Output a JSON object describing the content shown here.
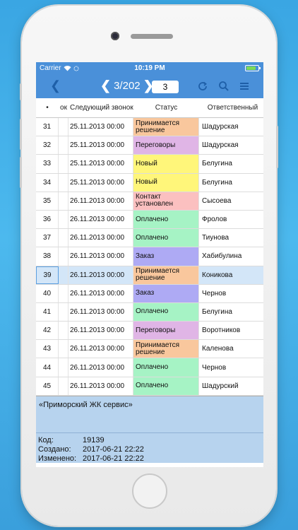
{
  "status_bar": {
    "carrier": "Carrier",
    "time": "10:19 PM",
    "battery_level": 0.8
  },
  "nav": {
    "pager": "3/202",
    "page_value": "3"
  },
  "columns": {
    "num": "•",
    "ok": "ок",
    "date": "Следующий звонок",
    "status": "Статус",
    "resp": "Ответственный"
  },
  "colors": {
    "header": "#4a90d9",
    "Принимается решение": "#f9c79d",
    "Переговоры": "#e0b5e6",
    "Новый": "#fff67a",
    "Контакт установлен": "#fbc0c0",
    "Оплачено": "#a6f3c5",
    "Заказ": "#aeaaf4"
  },
  "rows": [
    {
      "num": "31",
      "date": "25.11.2013 00:00",
      "status": "Принимается решение",
      "resp": "Шадурская"
    },
    {
      "num": "32",
      "date": "25.11.2013 00:00",
      "status": "Переговоры",
      "resp": "Шадурская"
    },
    {
      "num": "33",
      "date": "25.11.2013 00:00",
      "status": "Новый",
      "resp": "Белугина"
    },
    {
      "num": "34",
      "date": "25.11.2013 00:00",
      "status": "Новый",
      "resp": "Белугина"
    },
    {
      "num": "35",
      "date": "26.11.2013 00:00",
      "status": "Контакт установлен",
      "resp": "Сысоева"
    },
    {
      "num": "36",
      "date": "26.11.2013 00:00",
      "status": "Оплачено",
      "resp": "Фролов"
    },
    {
      "num": "37",
      "date": "26.11.2013 00:00",
      "status": "Оплачено",
      "resp": "Тиунова"
    },
    {
      "num": "38",
      "date": "26.11.2013 00:00",
      "status": "Заказ",
      "resp": "Хабибулина"
    },
    {
      "num": "39",
      "date": "26.11.2013 00:00",
      "status": "Принимается решение",
      "resp": "Коникова",
      "selected": true
    },
    {
      "num": "40",
      "date": "26.11.2013 00:00",
      "status": "Заказ",
      "resp": "Чернов"
    },
    {
      "num": "41",
      "date": "26.11.2013 00:00",
      "status": "Оплачено",
      "resp": "Белугина"
    },
    {
      "num": "42",
      "date": "26.11.2013 00:00",
      "status": "Переговоры",
      "resp": "Воротников"
    },
    {
      "num": "43",
      "date": "26.11.2013 00:00",
      "status": "Принимается решение",
      "resp": "Каленова"
    },
    {
      "num": "44",
      "date": "26.11.2013 00:00",
      "status": "Оплачено",
      "resp": "Чернов"
    },
    {
      "num": "45",
      "date": "26.11.2013 00:00",
      "status": "Оплачено",
      "resp": "Шадурский"
    }
  ],
  "company": "«Приморский ЖК сервис»",
  "info": {
    "code_label": "Код:",
    "code_value": "19139",
    "created_label": "Создано:",
    "created_value": "2017-06-21 22:22",
    "modified_label": "Изменено:",
    "modified_value": "2017-06-21 22:22"
  }
}
